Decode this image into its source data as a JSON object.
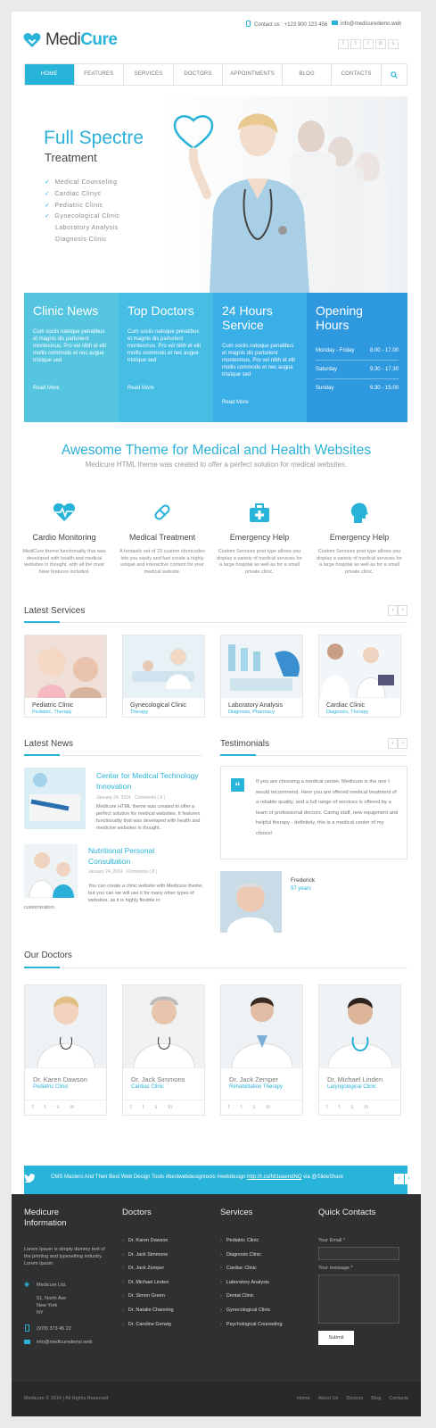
{
  "header": {
    "phone": "Contact us : +123 900 123 456",
    "email": "info@medicuredemo.web",
    "logo_main": "Medi",
    "logo_accent": "Cure",
    "social": [
      "f",
      "t",
      "r",
      "in",
      "s"
    ]
  },
  "nav": [
    "HOME",
    "FEATURES",
    "SERVICES",
    "DOCTORS",
    "APPOINTMENTS",
    "BLOG",
    "CONTACTS"
  ],
  "hero": {
    "title": "Full Spectre",
    "subtitle": "Treatment",
    "list": [
      "Medical Counseling",
      "Cardiac Clinyc",
      "Pediatric Clinic",
      "Gynecological Clinic",
      "Laboratory Analysis",
      "Diagnosis Clinic"
    ]
  },
  "boxes": [
    {
      "title": "Clinic News",
      "text": "Cum sociis natoque penatibus et magnis dis parturient montesmus. Pro vel nibh et elit mollis commodo et nec augue tristique sed",
      "link": "Read More",
      "color": "#55c5e0"
    },
    {
      "title": "Top Doctors",
      "text": "Cum sociis natoque penatibus et magnis dis parturient montesmus. Pro vel nibh et elit mollis commodo et nec augue tristique sed",
      "link": "Read More",
      "color": "#45bde4"
    },
    {
      "title": "24 Hours Service",
      "text": "Cum sociis natoque penatibus et magnis dis parturient montesmus. Pro vel nibh et elit mollis commodo et nec augue tristique sed",
      "link": "Read More",
      "color": "#3aaee6"
    },
    {
      "title": "Opening Hours",
      "color": "#2f99df"
    }
  ],
  "hours": [
    {
      "day": "Monday - Friday",
      "time": "8.00 - 17.00"
    },
    {
      "day": "Saturday",
      "time": "9.30 - 17.30"
    },
    {
      "day": "Sunday",
      "time": "9.30 - 15.00"
    }
  ],
  "intro": {
    "title": "Awesome Theme for Medical and Health Websites",
    "text": "Medicure HTML theme was created to offer a perfect solution for medical websites."
  },
  "features": [
    {
      "title": "Cardio Monitoring",
      "text": "MediCure theme functionality that was developed with health and medical websites in thought, with all the must have features included.",
      "icon": "heart-pulse-icon"
    },
    {
      "title": "Medical Treatment",
      "text": "A fantastic set of 23 custom shortcodes lets you easily and fast create a highly unique and interactive content for your medical website.",
      "icon": "pill-icon"
    },
    {
      "title": "Emergency Help",
      "text": "Custom Services post type allows you display a variety of medical services for a large hospital as well as for a small private clinic.",
      "icon": "medkit-icon"
    },
    {
      "title": "Emergency Help",
      "text": "Custom Services post type allows you display a variety of medical services for a large hospital as well as for a small private clinic.",
      "icon": "head-icon"
    }
  ],
  "latest_services": {
    "title": "Latest Services",
    "items": [
      {
        "name": "Pediatric Clinic",
        "cat": "Pediatric, Therapy"
      },
      {
        "name": "Gynecological Clinic",
        "cat": "Therapy"
      },
      {
        "name": "Laboratory Analysis",
        "cat": "Diagnosis, Pharmacy"
      },
      {
        "name": "Cardiac Clinic",
        "cat": "Diagnosis, Therapy"
      }
    ]
  },
  "news": {
    "title": "Latest News",
    "items": [
      {
        "title": "Center for Medical Technology Innovation",
        "date": "January 24, 2014",
        "comments": "Comments ( 8 )",
        "text": "Medicure HTML theme was created to offer a perfect solution for medical websites. It features functionality that was developed with health and medicine websites in thought."
      },
      {
        "title": "Nutritional Personal Consultation",
        "date": "January 24, 2014",
        "comments": "Comments ( 8 )",
        "text": "You can create a clinic website with Medicure theme, but you can we will use it for many other types of websites, as it is highly flexible in",
        "text_tail": "customization."
      }
    ]
  },
  "testimonials": {
    "title": "Testimonials",
    "quote": "If you are choosing a medical center, Medicure is the one I would recommend. Here you are offered medical treatment of a reliable quality, and a full range of services is offered by a team of professional doctors. Caring staff, new equipment and helpful therapy - definitely, this is a medical center of my choice!",
    "name": "Frederick",
    "age": "57 years"
  },
  "doctors": {
    "title": "Our Doctors",
    "items": [
      {
        "name": "Dr. Karen Dawson",
        "role": "Pediatric Clinic"
      },
      {
        "name": "Dr. Jack Simmons",
        "role": "Cardiac Clinic"
      },
      {
        "name": "Dr. Jack Zemper",
        "role": "Rehabilitation Therapy"
      },
      {
        "name": "Dr. Michael Linden",
        "role": "Laryngological Clinic"
      }
    ]
  },
  "tweet": {
    "text": "CMS Masters And Their Best Web Design Tools #bestwebdesigntools #webdesign",
    "link": "http://t.co/NI1oaendNQ",
    "via": "via @SlideShare"
  },
  "footer": {
    "col1": {
      "title": "Medicure Information",
      "text": "Lorem Ipsum is simply dummy text of the printing and typesetting industry. Lorem Ipsum",
      "company": "Medicure Ltd.",
      "address": [
        "51, North Ave",
        "New York",
        "NY"
      ],
      "phone": "(978) 373 45 22",
      "email": "info@medicuredemo.web"
    },
    "col2": {
      "title": "Doctors",
      "items": [
        "Dr. Karen Dawson",
        "Dr. Jack Simmons",
        "Dr. Jack Zemper",
        "Dr. Michael Linden",
        "Dr. Simon Green",
        "Dr. Natalie Channing",
        "Dr. Caroline Gerwig"
      ]
    },
    "col3": {
      "title": "Services",
      "items": [
        "Pediatric Clinic",
        "Diagnosis Clinic",
        "Cardiac Clinic",
        "Laboratory Analysis",
        "Dental Clinic",
        "Gynecological Clinic",
        "Psychological Counseling"
      ]
    },
    "col4": {
      "title": "Quick Contacts",
      "email_label": "Your Email *",
      "message_label": "Your message *",
      "submit": "Submit"
    },
    "copyright": "Medicure © 2014 | All Rights Reserved",
    "links": [
      "Home",
      "About Us",
      "Doctors",
      "Blog",
      "Contacts"
    ]
  },
  "colors": {
    "accent": "#28b3d8",
    "footer": "#2f3032"
  }
}
